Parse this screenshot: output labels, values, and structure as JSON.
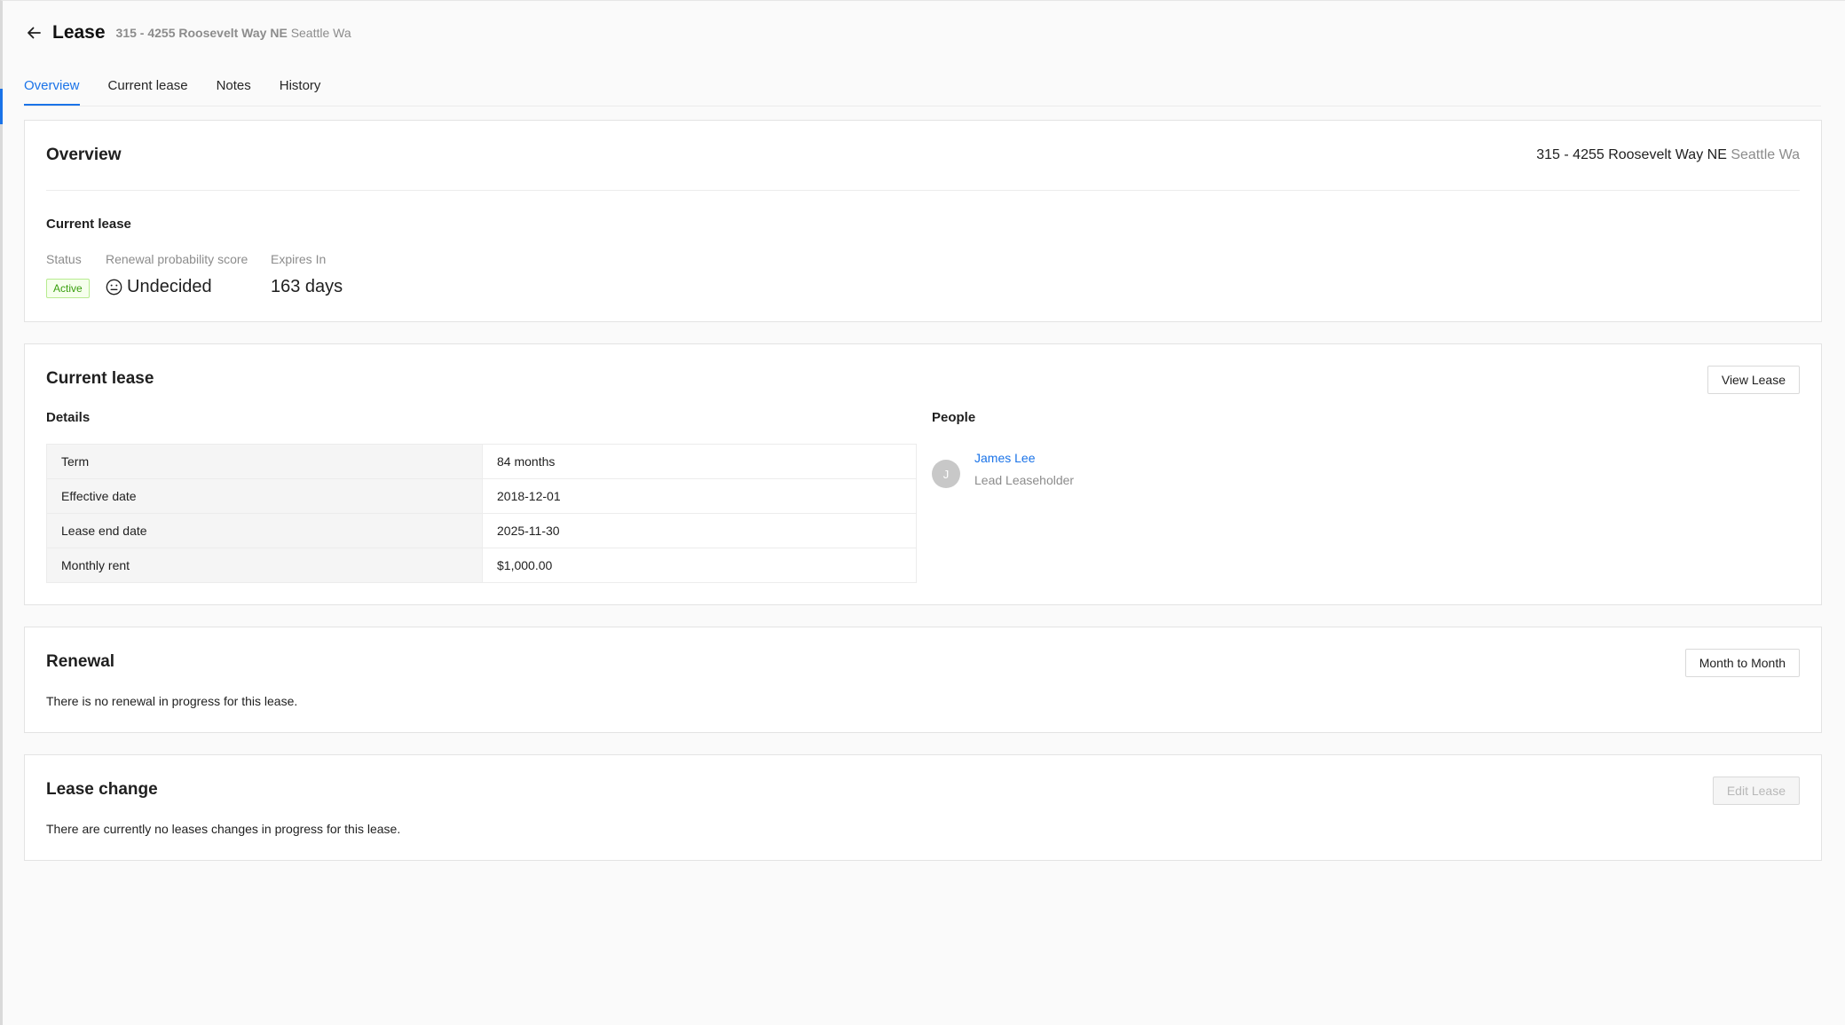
{
  "header": {
    "title": "Lease",
    "address": "315 - 4255 Roosevelt Way NE",
    "city": "Seattle Wa"
  },
  "tabs": [
    {
      "label": "Overview",
      "active": true
    },
    {
      "label": "Current lease",
      "active": false
    },
    {
      "label": "Notes",
      "active": false
    },
    {
      "label": "History",
      "active": false
    }
  ],
  "overview": {
    "title": "Overview",
    "address": "315 - 4255 Roosevelt Way NE",
    "city": "Seattle Wa",
    "section_label": "Current lease",
    "status_label": "Status",
    "status_value": "Active",
    "renewal_label": "Renewal probability score",
    "renewal_value": "Undecided",
    "expires_label": "Expires In",
    "expires_value": "163 days"
  },
  "current_lease": {
    "title": "Current lease",
    "view_button": "View Lease",
    "details_label": "Details",
    "details": [
      {
        "key": "Term",
        "value": "84 months"
      },
      {
        "key": "Effective date",
        "value": "2018-12-01"
      },
      {
        "key": "Lease end date",
        "value": "2025-11-30"
      },
      {
        "key": "Monthly rent",
        "value": "$1,000.00"
      }
    ],
    "people_label": "People",
    "person": {
      "initial": "J",
      "name": "James Lee",
      "role": "Lead Leaseholder"
    }
  },
  "renewal": {
    "title": "Renewal",
    "button": "Month to Month",
    "text": "There is no renewal in progress for this lease."
  },
  "lease_change": {
    "title": "Lease change",
    "button": "Edit Lease",
    "text": "There are currently no leases changes in progress for this lease."
  },
  "colors": {
    "accent": "#1a73e8",
    "active_badge": "#389e0d"
  }
}
